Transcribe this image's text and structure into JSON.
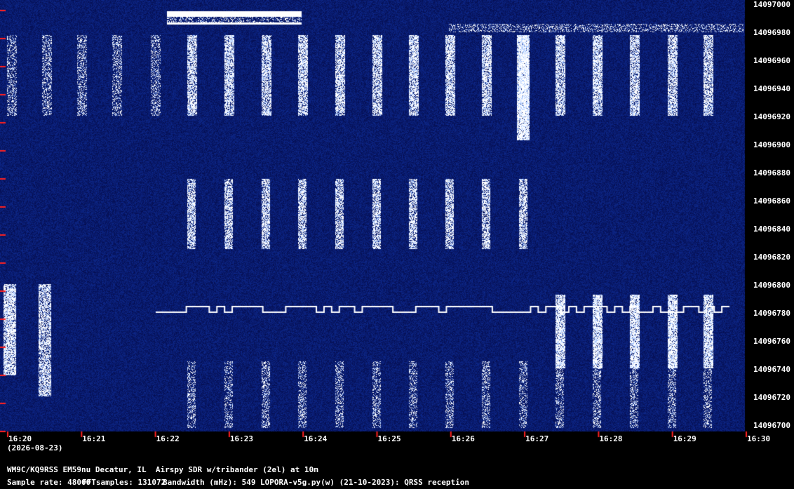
{
  "freq_labels": [
    "14097000",
    "14096980",
    "14096960",
    "14096940",
    "14096920",
    "14096900",
    "14096880",
    "14096860",
    "14096840",
    "14096820",
    "14096800",
    "14096780",
    "14096760",
    "14096740",
    "14096720",
    "14096700"
  ],
  "time_labels": [
    "16:20",
    "16:21",
    "16:22",
    "16:23",
    "16:24",
    "16:25",
    "16:26",
    "16:27",
    "16:28",
    "16:29",
    "16:30"
  ],
  "date": "(2026-08-23)",
  "footer": {
    "station": "WM9C/KQ9RSS EM59nu Decatur, IL  Airspy SDR w/tribander (2el) at 10m",
    "sample_rate_label": "Sample rate: 48000",
    "fft_label": "FFTsamples: 131072",
    "bandwidth_label": "Bandwidth (mHz): 549",
    "software_label": "LOPORA-v5g.py(w) (21-10-2023): QRSS reception"
  },
  "colors": {
    "background": "#0b2a5a",
    "signal": "#ffffff",
    "tick": "#ff2020"
  }
}
